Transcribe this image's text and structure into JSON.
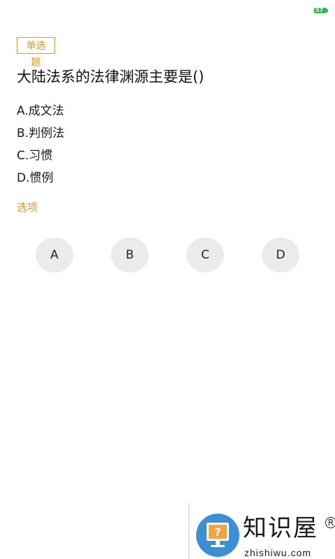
{
  "status_bar": {
    "battery_text": "57",
    "battery_color": "#2fb84a"
  },
  "question": {
    "type_label": "单选题",
    "text": "大陆法系的法律渊源主要是()",
    "options": [
      "A.成文法",
      "B.判例法",
      "C.习惯",
      "D.惯例"
    ]
  },
  "answer": {
    "label": "选项",
    "buttons": [
      "A",
      "B",
      "C",
      "D"
    ]
  },
  "watermark": {
    "brand": "知识屋",
    "site": "zhishiwu.com",
    "reg_mark": "R",
    "logo_icon": "help-monitor-icon"
  },
  "colors": {
    "accent": "#d39a2c",
    "button_bg": "#ebebeb",
    "logo_blue": "#3a8fd6"
  }
}
